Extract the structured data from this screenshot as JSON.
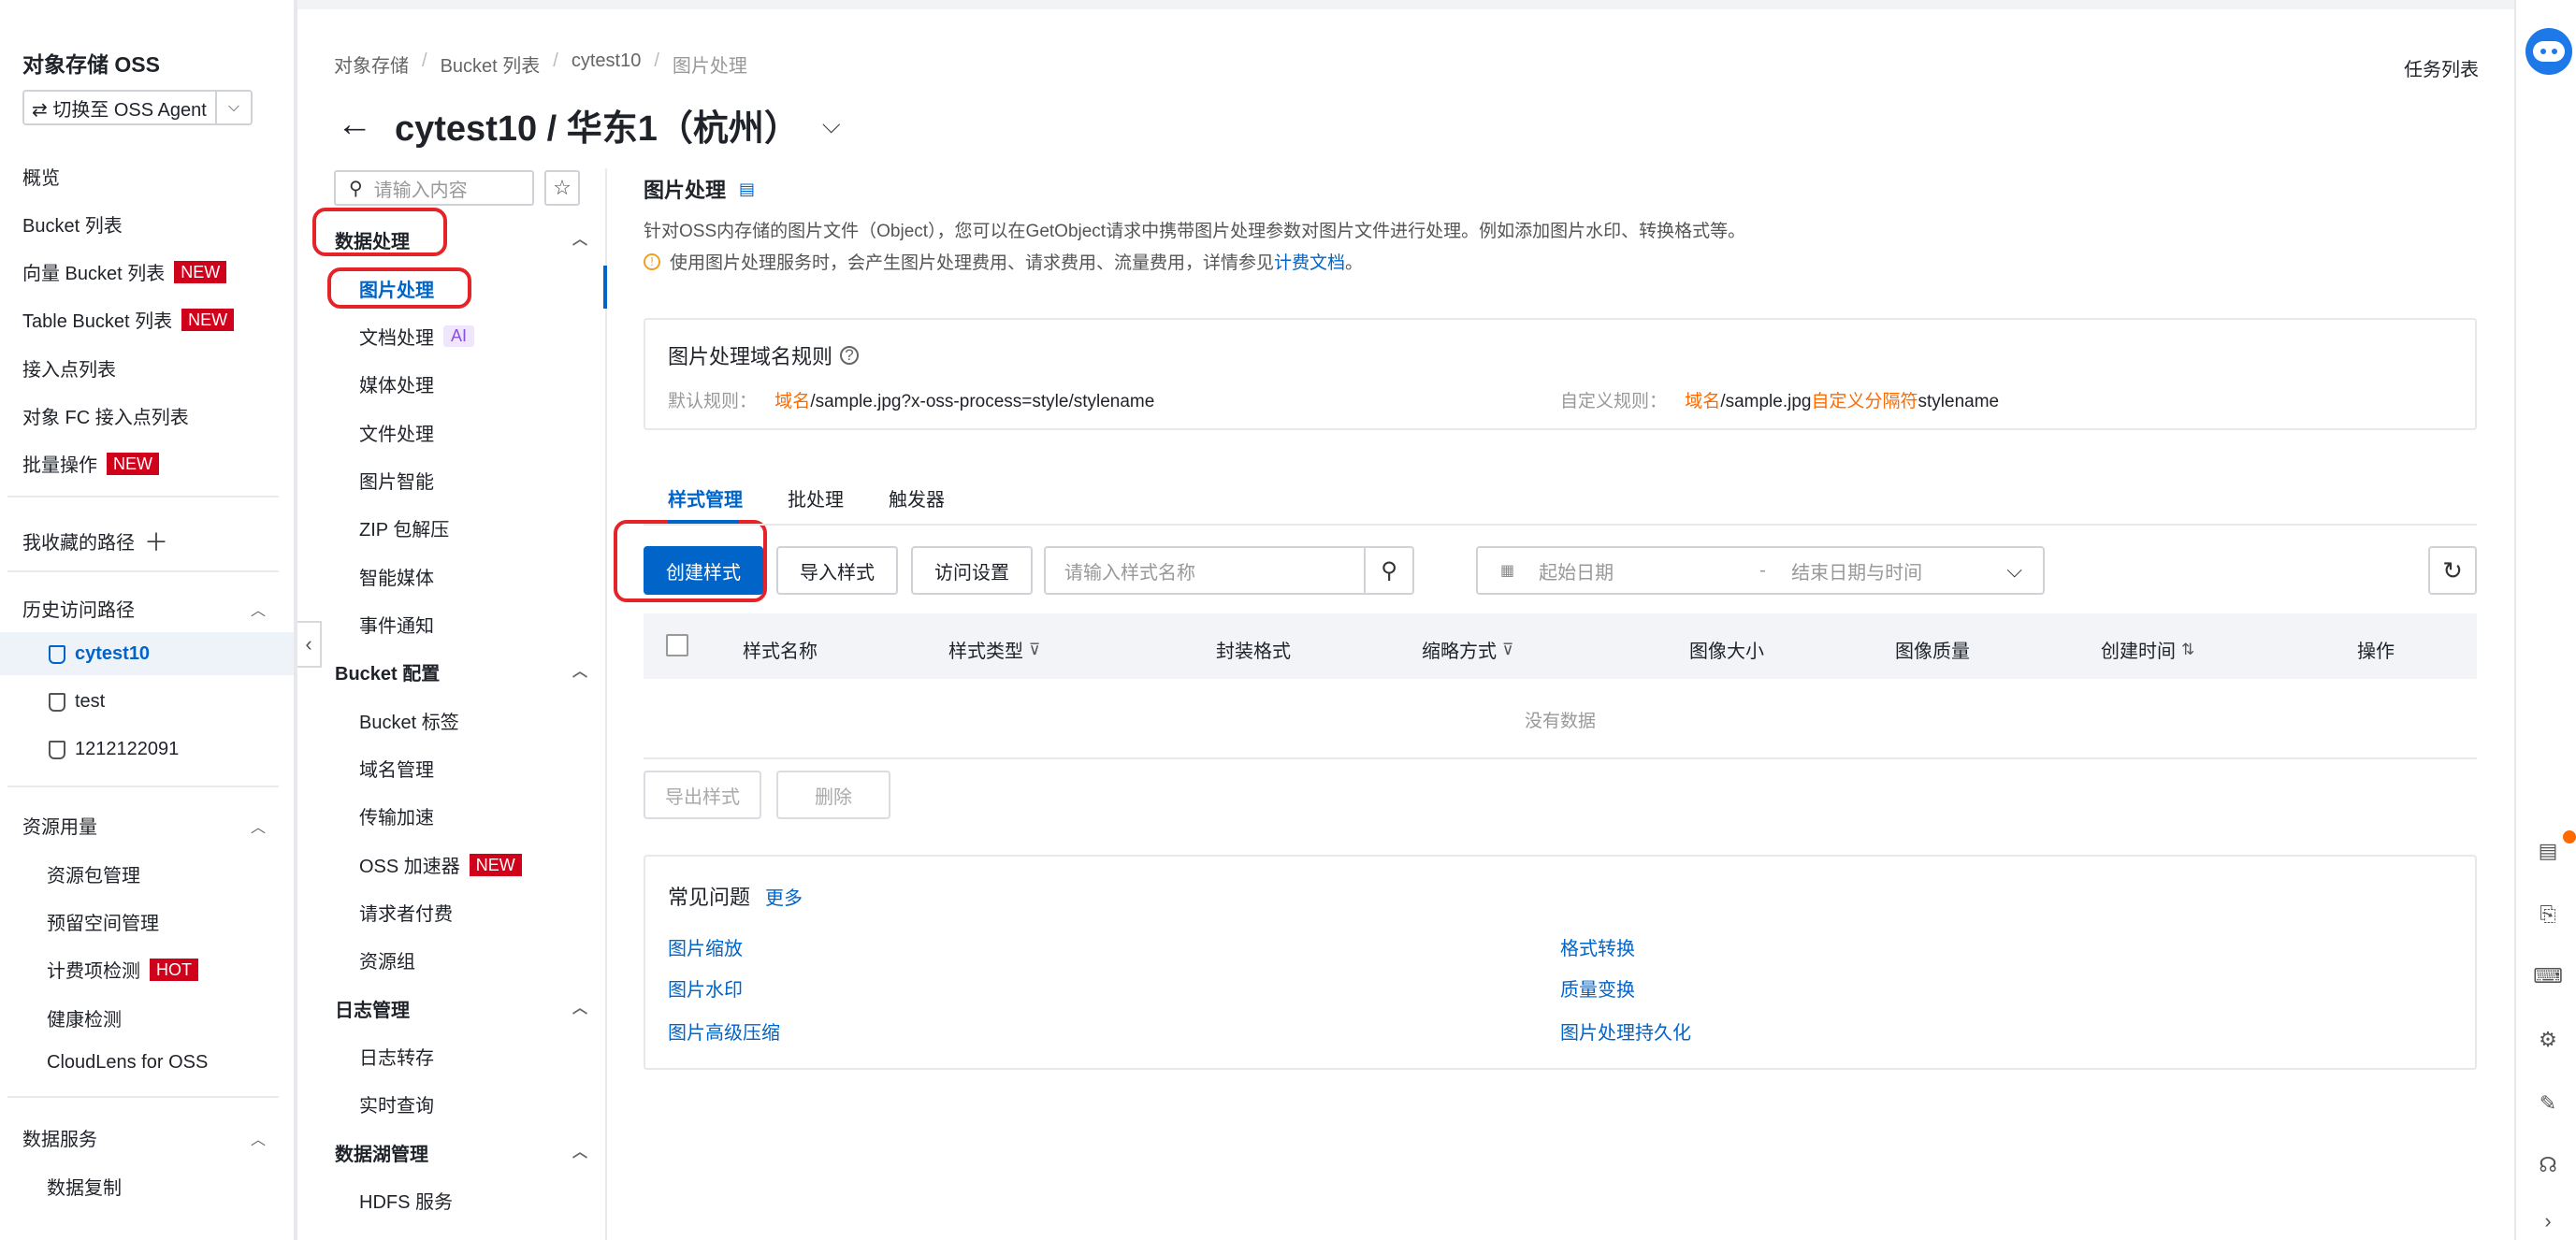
{
  "app": {
    "title": "对象存储 OSS",
    "agent_switch": "⇄ 切换至 OSS Agent",
    "task_list": "任务列表"
  },
  "sidebar": {
    "items": [
      {
        "label": "概览"
      },
      {
        "label": "Bucket 列表"
      },
      {
        "label": "向量 Bucket 列表",
        "badge": "NEW"
      },
      {
        "label": "Table Bucket 列表",
        "badge": "NEW"
      },
      {
        "label": "接入点列表"
      },
      {
        "label": "对象 FC 接入点列表"
      },
      {
        "label": "批量操作",
        "badge": "NEW"
      }
    ],
    "favorites": "我收藏的路径",
    "history_title": "历史访问路径",
    "history": [
      "cytest10",
      "test",
      "1212122091"
    ],
    "resource_title": "资源用量",
    "resource_items": [
      {
        "label": "资源包管理"
      },
      {
        "label": "预留空间管理"
      },
      {
        "label": "计费项检测",
        "badge": "HOT"
      },
      {
        "label": "健康检测"
      },
      {
        "label": "CloudLens for OSS"
      }
    ],
    "data_service_title": "数据服务",
    "data_service_items": [
      "数据复制"
    ]
  },
  "breadcrumb": [
    "对象存储",
    "Bucket 列表",
    "cytest10",
    "图片处理"
  ],
  "page_title": "cytest10 / 华东1（杭州）",
  "submenu": {
    "search_placeholder": "请输入内容",
    "groups": [
      {
        "title": "数据处理",
        "items": [
          "图片处理",
          "文档处理",
          "媒体处理",
          "文件处理",
          "图片智能",
          "ZIP 包解压",
          "智能媒体",
          "事件通知"
        ]
      },
      {
        "title": "Bucket 配置",
        "items": [
          "Bucket 标签",
          "域名管理",
          "传输加速",
          "OSS 加速器",
          "请求者付费",
          "资源组"
        ]
      },
      {
        "title": "日志管理",
        "items": [
          "日志转存",
          "实时查询"
        ]
      },
      {
        "title": "数据湖管理",
        "items": [
          "HDFS 服务"
        ]
      }
    ],
    "ai_badge": "AI",
    "new_badge": "NEW"
  },
  "content": {
    "section_title": "图片处理",
    "description": "针对OSS内存储的图片文件（Object），您可以在GetObject请求中携带图片处理参数对图片文件进行处理。例如添加图片水印、转换格式等。",
    "warning_text": "使用图片处理服务时，会产生图片处理费用、请求费用、流量费用，详情参见",
    "warning_link": "计费文档",
    "warning_end": "。",
    "rule_box": {
      "title": "图片处理域名规则",
      "default_label": "默认规则：",
      "default_domain": "域名",
      "default_rest": "/sample.jpg?x-oss-process=style/stylename",
      "custom_label": "自定义规则：",
      "custom_domain": "域名",
      "custom_mid": "/sample.jpg",
      "custom_sep": "自定义分隔符",
      "custom_rest": "stylename"
    },
    "tabs": [
      "样式管理",
      "批处理",
      "触发器"
    ],
    "toolbar": {
      "create": "创建样式",
      "import": "导入样式",
      "access": "访问设置",
      "name_placeholder": "请输入样式名称",
      "start_date": "起始日期",
      "date_sep": "-",
      "end_date": "结束日期与时间"
    },
    "table": {
      "columns": [
        "样式名称",
        "样式类型",
        "封装格式",
        "缩略方式",
        "图像大小",
        "图像质量",
        "创建时间",
        "操作"
      ],
      "empty": "没有数据"
    },
    "bulk": {
      "export": "导出样式",
      "delete": "删除"
    },
    "faq": {
      "title": "常见问题",
      "more": "更多",
      "left": [
        "图片缩放",
        "图片水印",
        "图片高级压缩"
      ],
      "right": [
        "格式转换",
        "质量变换",
        "图片处理持久化"
      ]
    }
  },
  "colors": {
    "accent": "#0064c8",
    "badge": "#d0021b",
    "highlight": "#e5242a",
    "orange": "#ff6a00"
  }
}
